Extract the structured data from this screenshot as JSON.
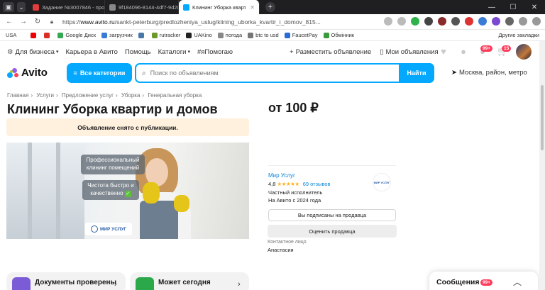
{
  "browser": {
    "tabs": [
      {
        "title": "",
        "color": "#3a3a3e"
      },
      {
        "title": "Задание №3007846 - про",
        "color": "#e23d3d"
      },
      {
        "title": "9f184096-8144-4df7-9d28",
        "color": "#888888"
      },
      {
        "title": "Клининг Уборка квартир",
        "color": "#04a9ff"
      }
    ],
    "new_tab_label": "+",
    "url_prefix": "https://",
    "url_domain": "www.avito.ru",
    "url_path": "/sankt-peterburg/predlozheniya_uslug/klining_uborka_kvartir_i_domov_815..."
  },
  "bookmarks": {
    "items": [
      "USA",
      "",
      "",
      "",
      "Google Диск",
      "",
      "загрузчик",
      "",
      "",
      "rutracker",
      "UAKino",
      "",
      "погода",
      "btc to usd",
      "FaucetPay",
      "",
      "Обмінник",
      "",
      "",
      "",
      ""
    ],
    "other": "Другие закладки"
  },
  "header": {
    "nav": [
      "Для бизнеса",
      "Карьера в Авито",
      "Помощь",
      "Каталоги",
      "#яПомогаю"
    ],
    "place_ad": "Разместить объявление",
    "my_ads": "Мои объявления",
    "msg_badge": "99+",
    "cart_badge": "15",
    "logo": "Avito",
    "categories": "Все категории",
    "search_placeholder": "Поиск по объявлениям",
    "search_button": "Найти",
    "location": "Москва, район, метро"
  },
  "breadcrumbs": [
    "Главная",
    "Услуги",
    "Предложение услуг",
    "Уборка",
    "Генеральная уборка"
  ],
  "listing": {
    "title": "Клининг Уборка квартир и домов",
    "removed_notice": "Объявление снято с публикации.",
    "photo_text_1": "Профессиональный клининг помещений",
    "photo_text_2": "Чистота быстро и качественно",
    "photo_check": "✓",
    "photo_logo": "МИР УСЛУГ",
    "price": "от 100 ₽"
  },
  "seller": {
    "name": "Мир Услуг",
    "rating": "4,8",
    "stars": "★★★★★",
    "reviews": "69 отзывов",
    "type": "Частный исполнитель",
    "since": "На Авито с 2024 года",
    "logo_text": "МИР УСЛУГ",
    "subscribed_button": "Вы подписаны на продавца",
    "rate_button": "Оценить продавца",
    "contact_label": "Контактное лицо",
    "contact_name": "Анастасия"
  },
  "cards": [
    {
      "title": "Документы проверены",
      "icon_color": "#7b5cd6"
    },
    {
      "title": "Может сегодня",
      "icon_color": "#2aa84a"
    }
  ],
  "messenger": {
    "title": "Сообщения",
    "badge": "99+"
  }
}
